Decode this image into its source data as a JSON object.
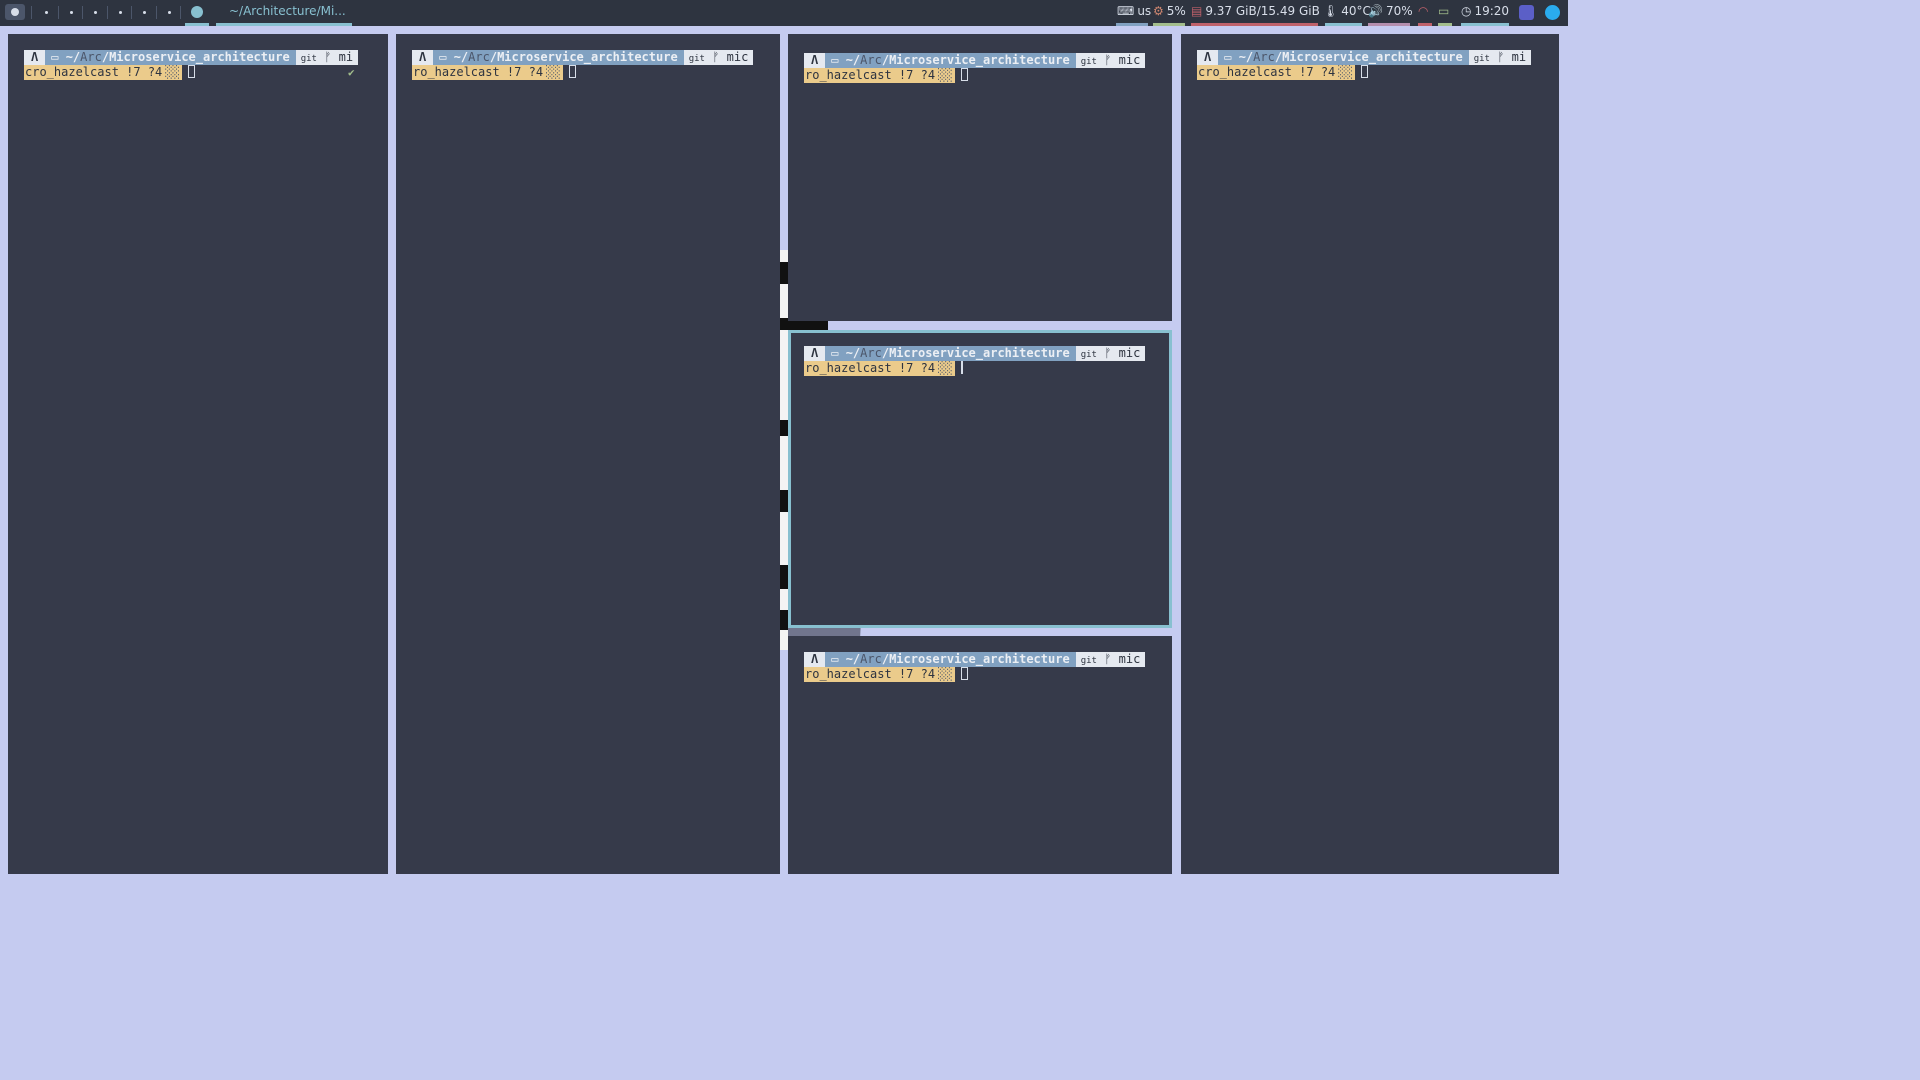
{
  "topbar": {
    "window_title": "~/Architecture/Mi...",
    "keyboard_layout": "us",
    "cpu": "5%",
    "memory": "9.37 GiB/15.49 GiB",
    "temperature": "40°C",
    "volume": "70%",
    "clock": "19:20",
    "icons": [
      "launcher-icon",
      "keyboard-icon",
      "cpu-icon",
      "memory-icon",
      "thermometer-icon",
      "volume-icon",
      "wifi-icon",
      "battery-icon",
      "clock-icon",
      "teams-icon",
      "telegram-icon"
    ]
  },
  "prompt": {
    "arch_symbol": "Λ",
    "folder_symbol": "▭",
    "home": "~/",
    "dim_dir": "Arc",
    "dir": "/Microservice_architecture",
    "git_label": "git",
    "branch_symbol": "ᚠ",
    "shade": "░░",
    "check": "✔"
  },
  "panes": [
    {
      "branch_line1": "mi",
      "branch_line2": "cro_hazelcast !7 ?4"
    },
    {
      "branch_line1": "mic",
      "branch_line2": "ro_hazelcast !7 ?4"
    },
    {
      "branch_line1": "mic",
      "branch_line2": "ro_hazelcast !7 ?4"
    },
    {
      "branch_line1": "mi",
      "branch_line2": "cro_hazelcast !7 ?4"
    },
    {
      "branch_line1": "mic",
      "branch_line2": "ro_hazelcast !7 ?4"
    },
    {
      "branch_line1": "mic",
      "branch_line2": "ro_hazelcast !7 ?4"
    }
  ],
  "colors": {
    "bar_bg": "#2e3440",
    "pane_bg": "#363a4a",
    "focus_border": "#88c0d0",
    "gap": "#c5cbf0",
    "path_segment": "#81a1c1",
    "branch_segment": "#ebcb8b"
  }
}
